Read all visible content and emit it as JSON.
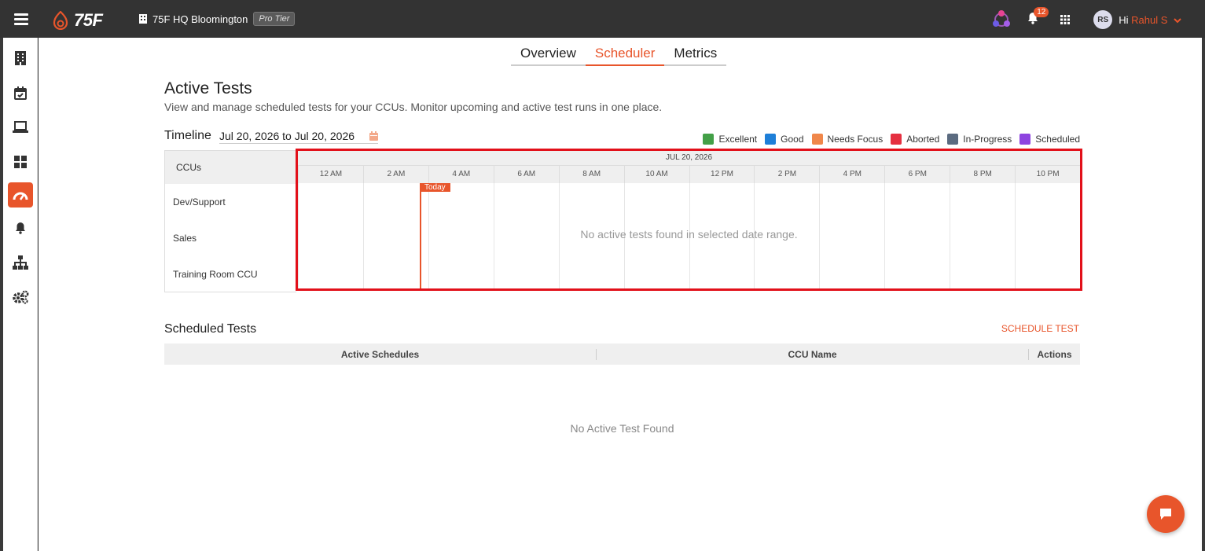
{
  "header": {
    "logo_text": "75F",
    "building_name": "75F HQ Bloomington",
    "tier_badge": "Pro Tier",
    "notification_count": "12",
    "avatar_initials": "RS",
    "greeting": "Hi",
    "user_name": "Rahul S"
  },
  "tabs": [
    {
      "label": "Overview"
    },
    {
      "label": "Scheduler"
    },
    {
      "label": "Metrics"
    }
  ],
  "page": {
    "title": "Active Tests",
    "subtitle": "View and manage scheduled tests for your CCUs. Monitor upcoming and active test runs in one place."
  },
  "timeline": {
    "label": "Timeline",
    "date_range": "Jul 20, 2026 to Jul 20, 2026",
    "date_header": "JUL 20, 2026",
    "ccus_header": "CCUs",
    "today_label": "Today",
    "hours": [
      "12 AM",
      "2 AM",
      "4 AM",
      "6 AM",
      "8 AM",
      "10 AM",
      "12 PM",
      "2 PM",
      "4 PM",
      "6 PM",
      "8 PM",
      "10 PM"
    ],
    "ccus": [
      "Dev/Support",
      "Sales",
      "Training Room CCU"
    ],
    "empty_message": "No active tests found in selected date range."
  },
  "legend": [
    {
      "label": "Excellent",
      "color": "#43a047"
    },
    {
      "label": "Good",
      "color": "#1e7fd8"
    },
    {
      "label": "Needs Focus",
      "color": "#f0874a"
    },
    {
      "label": "Aborted",
      "color": "#e53040"
    },
    {
      "label": "In-Progress",
      "color": "#5b6b80"
    },
    {
      "label": "Scheduled",
      "color": "#8e44e0"
    }
  ],
  "scheduled": {
    "title": "Scheduled Tests",
    "schedule_button": "SCHEDULE TEST",
    "columns": [
      "Active Schedules",
      "CCU Name",
      "Actions"
    ],
    "empty_message": "No Active Test Found"
  },
  "colors": {
    "accent": "#e8552b",
    "highlight": "#e2101a"
  }
}
